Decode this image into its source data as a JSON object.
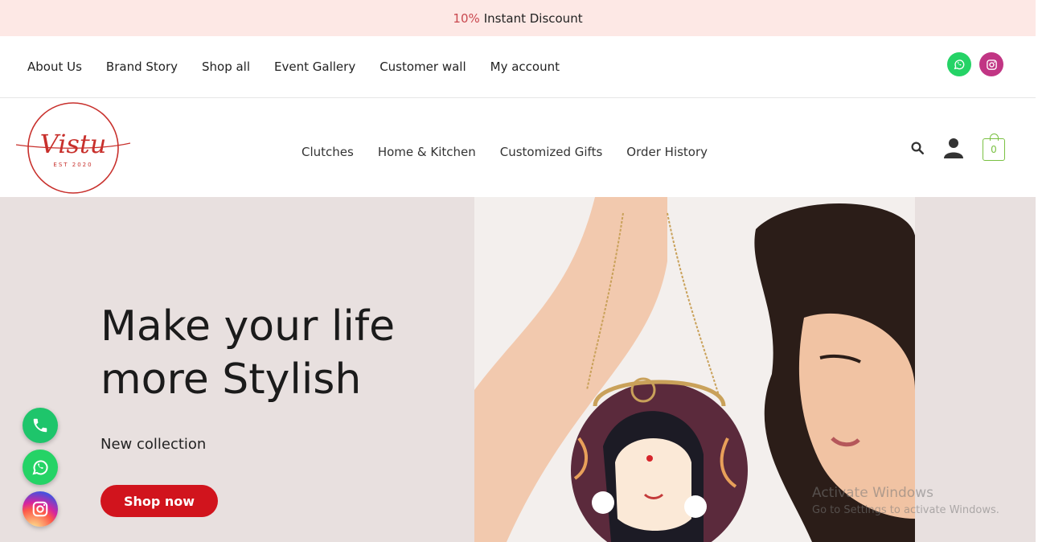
{
  "announcement": {
    "percent": "10%",
    "text": "Instant Discount"
  },
  "top_nav": [
    "About Us",
    "Brand Story",
    "Shop all",
    "Event Gallery",
    "Customer wall",
    "My account"
  ],
  "logo": {
    "name": "Vistu",
    "tagline": "EST 2020"
  },
  "main_nav": [
    "Clutches",
    "Home & Kitchen",
    "Customized Gifts",
    "Order History"
  ],
  "cart": {
    "count": "0"
  },
  "hero": {
    "line1": "Make your life",
    "line2": "more Stylish",
    "subtitle": "New collection",
    "cta": "Shop now"
  },
  "os_watermark": {
    "title": "Activate Windows",
    "subtitle": "Go to Settings to activate Windows."
  },
  "colors": {
    "accent": "#d1141d",
    "topbar": "#fde8e5",
    "hero_bg": "#e8e0df",
    "whatsapp": "#25d366",
    "cart": "#7ac142"
  },
  "icons": [
    "whatsapp-icon",
    "instagram-icon",
    "search-icon",
    "user-icon",
    "cart-icon",
    "phone-icon"
  ]
}
